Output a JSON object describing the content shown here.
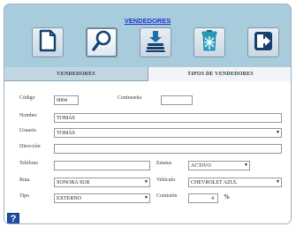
{
  "window": {
    "title": "VENDEDORES"
  },
  "toolbar": {
    "buttons": [
      {
        "name": "new-document-icon",
        "tooltip": ""
      },
      {
        "name": "search-icon",
        "tooltip": ""
      },
      {
        "name": "database-icon",
        "tooltip": ""
      },
      {
        "name": "trash-icon",
        "tooltip": ""
      },
      {
        "name": "exit-icon",
        "tooltip": ""
      }
    ]
  },
  "tabs": [
    {
      "label": "VENDEDORES"
    },
    {
      "label": "TIPOS DE VENDEDORES"
    }
  ],
  "form": {
    "codigo": {
      "label": "Código",
      "value": "0004"
    },
    "contrasena": {
      "label": "Contraseña",
      "value": ""
    },
    "nombre": {
      "label": "Nombre",
      "value": "TOMÁS"
    },
    "usuario": {
      "label": "Usuario",
      "value": "TOMÁS"
    },
    "direccion": {
      "label": "Dirección",
      "value": ""
    },
    "telefono": {
      "label": "Teléfono",
      "value": ""
    },
    "estatus": {
      "label": "Estatus",
      "value": "ACTIVO"
    },
    "ruta": {
      "label": "Ruta",
      "value": "SONORA SUR"
    },
    "vehiculo": {
      "label": "Vehículo",
      "value": "CHEVROLET AZUL"
    },
    "tipo": {
      "label": "Tipo",
      "value": "EXTERNO"
    },
    "comision": {
      "label": "Comisión",
      "value": "4",
      "unit": "%"
    }
  },
  "help": {
    "label": "?"
  },
  "colors": {
    "frame": "#a9ccdc",
    "title": "#2233cc",
    "icon_blue": "#1f6fb0",
    "icon_teal": "#27a7c4",
    "icon_dark": "#15406e"
  }
}
